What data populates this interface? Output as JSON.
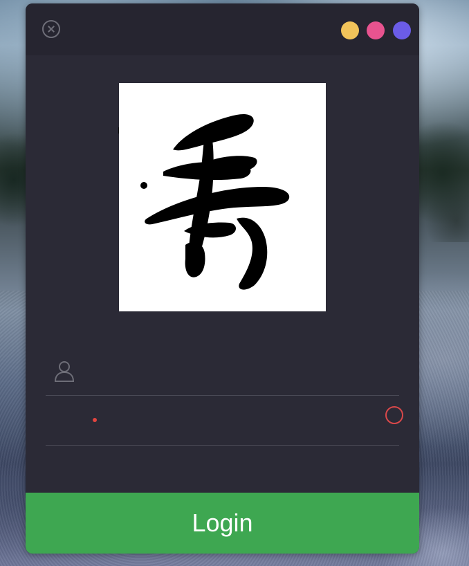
{
  "window": {
    "controls": {
      "close_icon": "close-circle-icon",
      "dots": [
        {
          "name": "minimize",
          "color": "#f2c45a"
        },
        {
          "name": "maximize",
          "color": "#e8538f"
        },
        {
          "name": "theme",
          "color": "#6b5ce7"
        }
      ]
    }
  },
  "logo": {
    "glyph": "秀",
    "style": "calligraphy"
  },
  "form": {
    "username": {
      "value": "",
      "placeholder": "",
      "icon": "user-icon"
    },
    "password": {
      "value": "",
      "placeholder": ""
    },
    "status": {
      "indicator_color": "#e2453f",
      "loading_icon": "loading-ring-icon"
    }
  },
  "actions": {
    "login_label": "Login",
    "login_color": "#3ea751"
  },
  "theme": {
    "dialog_bg": "#2b2a36",
    "titlebar_bg": "#262530",
    "text_color": "#ffffff"
  }
}
